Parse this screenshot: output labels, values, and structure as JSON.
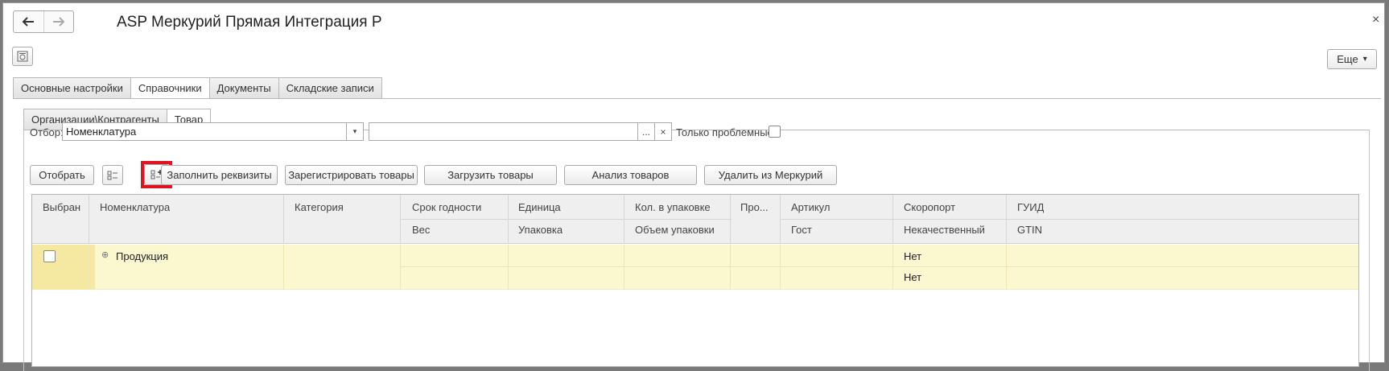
{
  "window": {
    "title": "ASP Меркурий Прямая Интеграция Р",
    "close_glyph": "×",
    "back_glyph": "back-arrow-icon",
    "forward_glyph": "forward-arrow-icon",
    "more_label": "Еще",
    "more_caret": "▾"
  },
  "tabs": [
    "Основные настройки",
    "Справочники",
    "Документы",
    "Складские записи"
  ],
  "active_tab": "Справочники",
  "subtabs": [
    "Организации\\Контрагенты",
    "Товар"
  ],
  "active_subtab": "Товар",
  "filter": {
    "label": "Отбор:",
    "value": "Номенклатура",
    "dropdown_glyph": "▾",
    "search_value": "",
    "ellipsis_glyph": "...",
    "clear_glyph": "×",
    "problems_label": "Только проблемные:",
    "problems_checked": false
  },
  "buttons": {
    "select": "Отобрать",
    "fill": "Заполнить реквизиты",
    "register": "Зарегистрировать товары",
    "load": "Загрузить товары",
    "analyze": "Анализ товаров",
    "delete": "Удалить из Меркурий"
  },
  "table": {
    "headers_top": [
      "Выбран",
      "Номенклатура",
      "Категория",
      "Срок годности",
      "Единица",
      "Кол. в упаковке",
      "Про...",
      "Артикул",
      "Скоропорт",
      "ГУИД"
    ],
    "headers_bottom": [
      "Вес",
      "Упаковка",
      "Объем упаковки",
      "Гост",
      "Некачественный",
      "GTIN"
    ],
    "rows": [
      {
        "selected": false,
        "expand_glyph": "⊕",
        "name": "Продукция",
        "perishable": "Нет",
        "defective": "Нет"
      }
    ]
  },
  "colors": {
    "row_bg": "#fbf7cf",
    "row_selected_bg": "#f5e8a0",
    "highlight": "#e0141e"
  }
}
